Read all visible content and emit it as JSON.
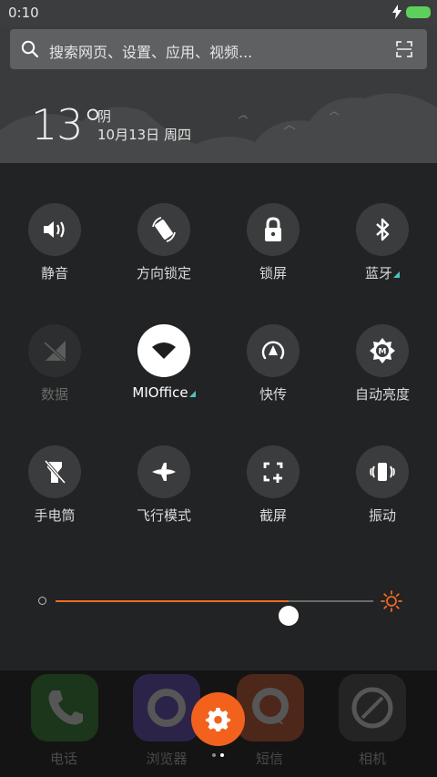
{
  "status_bar": {
    "time": "0:10",
    "accent": "#5dd05b"
  },
  "search": {
    "placeholder": "搜索网页、设置、应用、视频..."
  },
  "weather": {
    "temperature": "13°",
    "condition": "阴",
    "date": "10月13日 周四"
  },
  "toggles": [
    {
      "id": "mute",
      "label": "静音",
      "icon": "speaker-icon",
      "state": "off"
    },
    {
      "id": "rotation-lock",
      "label": "方向锁定",
      "icon": "rotation-lock-icon",
      "state": "off"
    },
    {
      "id": "lock-screen",
      "label": "锁屏",
      "icon": "lock-icon",
      "state": "off"
    },
    {
      "id": "bluetooth",
      "label": "蓝牙",
      "icon": "bluetooth-icon",
      "state": "off",
      "expandable": true
    },
    {
      "id": "data",
      "label": "数据",
      "icon": "mobile-data-off-icon",
      "state": "disabled"
    },
    {
      "id": "wifi",
      "label": "MIOffice",
      "icon": "wifi-icon",
      "state": "on",
      "expandable": true
    },
    {
      "id": "quick-transfer",
      "label": "快传",
      "icon": "quick-transfer-icon",
      "state": "off"
    },
    {
      "id": "auto-brightness",
      "label": "自动亮度",
      "icon": "auto-brightness-icon",
      "state": "off"
    },
    {
      "id": "flashlight",
      "label": "手电筒",
      "icon": "flashlight-icon",
      "state": "off"
    },
    {
      "id": "airplane",
      "label": "飞行模式",
      "icon": "airplane-icon",
      "state": "off"
    },
    {
      "id": "screenshot",
      "label": "截屏",
      "icon": "screenshot-icon",
      "state": "off"
    },
    {
      "id": "vibrate",
      "label": "振动",
      "icon": "vibrate-icon",
      "state": "off"
    }
  ],
  "brightness": {
    "level": 0.733,
    "accent": "#f16a24"
  },
  "dock": {
    "apps": [
      {
        "label": "电话",
        "color": "#2f8f2e",
        "icon": "phone-icon"
      },
      {
        "label": "浏览器",
        "color": "#6c4fcf",
        "icon": "browser-icon"
      },
      {
        "label": "短信",
        "color": "#e05a2a",
        "icon": "message-icon"
      },
      {
        "label": "相机",
        "color": "#505050",
        "icon": "camera-icon"
      }
    ]
  },
  "settings_button": {
    "icon": "gear-icon",
    "color": "#f2621d"
  },
  "page_indicator": {
    "count": 2,
    "current": 1
  }
}
